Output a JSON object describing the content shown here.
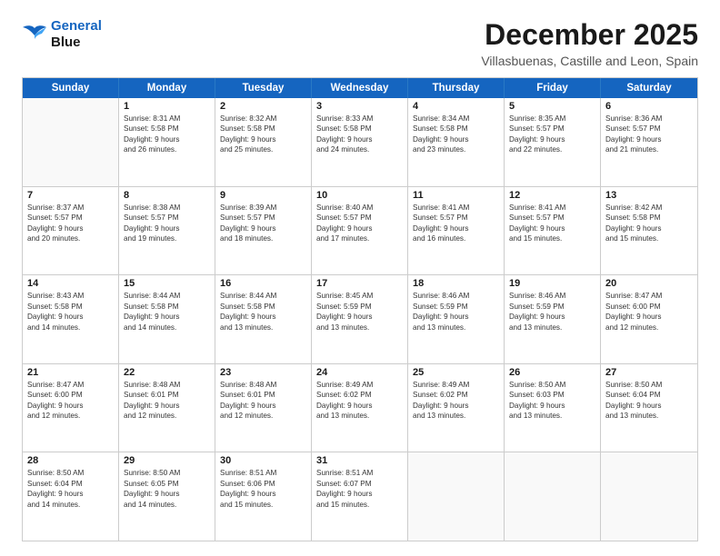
{
  "header": {
    "logo_line1": "General",
    "logo_line2": "Blue",
    "month_title": "December 2025",
    "location": "Villasbuenas, Castille and Leon, Spain"
  },
  "days_of_week": [
    "Sunday",
    "Monday",
    "Tuesday",
    "Wednesday",
    "Thursday",
    "Friday",
    "Saturday"
  ],
  "weeks": [
    [
      {
        "day": "",
        "info": ""
      },
      {
        "day": "1",
        "info": "Sunrise: 8:31 AM\nSunset: 5:58 PM\nDaylight: 9 hours\nand 26 minutes."
      },
      {
        "day": "2",
        "info": "Sunrise: 8:32 AM\nSunset: 5:58 PM\nDaylight: 9 hours\nand 25 minutes."
      },
      {
        "day": "3",
        "info": "Sunrise: 8:33 AM\nSunset: 5:58 PM\nDaylight: 9 hours\nand 24 minutes."
      },
      {
        "day": "4",
        "info": "Sunrise: 8:34 AM\nSunset: 5:58 PM\nDaylight: 9 hours\nand 23 minutes."
      },
      {
        "day": "5",
        "info": "Sunrise: 8:35 AM\nSunset: 5:57 PM\nDaylight: 9 hours\nand 22 minutes."
      },
      {
        "day": "6",
        "info": "Sunrise: 8:36 AM\nSunset: 5:57 PM\nDaylight: 9 hours\nand 21 minutes."
      }
    ],
    [
      {
        "day": "7",
        "info": "Sunrise: 8:37 AM\nSunset: 5:57 PM\nDaylight: 9 hours\nand 20 minutes."
      },
      {
        "day": "8",
        "info": "Sunrise: 8:38 AM\nSunset: 5:57 PM\nDaylight: 9 hours\nand 19 minutes."
      },
      {
        "day": "9",
        "info": "Sunrise: 8:39 AM\nSunset: 5:57 PM\nDaylight: 9 hours\nand 18 minutes."
      },
      {
        "day": "10",
        "info": "Sunrise: 8:40 AM\nSunset: 5:57 PM\nDaylight: 9 hours\nand 17 minutes."
      },
      {
        "day": "11",
        "info": "Sunrise: 8:41 AM\nSunset: 5:57 PM\nDaylight: 9 hours\nand 16 minutes."
      },
      {
        "day": "12",
        "info": "Sunrise: 8:41 AM\nSunset: 5:57 PM\nDaylight: 9 hours\nand 15 minutes."
      },
      {
        "day": "13",
        "info": "Sunrise: 8:42 AM\nSunset: 5:58 PM\nDaylight: 9 hours\nand 15 minutes."
      }
    ],
    [
      {
        "day": "14",
        "info": "Sunrise: 8:43 AM\nSunset: 5:58 PM\nDaylight: 9 hours\nand 14 minutes."
      },
      {
        "day": "15",
        "info": "Sunrise: 8:44 AM\nSunset: 5:58 PM\nDaylight: 9 hours\nand 14 minutes."
      },
      {
        "day": "16",
        "info": "Sunrise: 8:44 AM\nSunset: 5:58 PM\nDaylight: 9 hours\nand 13 minutes."
      },
      {
        "day": "17",
        "info": "Sunrise: 8:45 AM\nSunset: 5:59 PM\nDaylight: 9 hours\nand 13 minutes."
      },
      {
        "day": "18",
        "info": "Sunrise: 8:46 AM\nSunset: 5:59 PM\nDaylight: 9 hours\nand 13 minutes."
      },
      {
        "day": "19",
        "info": "Sunrise: 8:46 AM\nSunset: 5:59 PM\nDaylight: 9 hours\nand 13 minutes."
      },
      {
        "day": "20",
        "info": "Sunrise: 8:47 AM\nSunset: 6:00 PM\nDaylight: 9 hours\nand 12 minutes."
      }
    ],
    [
      {
        "day": "21",
        "info": "Sunrise: 8:47 AM\nSunset: 6:00 PM\nDaylight: 9 hours\nand 12 minutes."
      },
      {
        "day": "22",
        "info": "Sunrise: 8:48 AM\nSunset: 6:01 PM\nDaylight: 9 hours\nand 12 minutes."
      },
      {
        "day": "23",
        "info": "Sunrise: 8:48 AM\nSunset: 6:01 PM\nDaylight: 9 hours\nand 12 minutes."
      },
      {
        "day": "24",
        "info": "Sunrise: 8:49 AM\nSunset: 6:02 PM\nDaylight: 9 hours\nand 13 minutes."
      },
      {
        "day": "25",
        "info": "Sunrise: 8:49 AM\nSunset: 6:02 PM\nDaylight: 9 hours\nand 13 minutes."
      },
      {
        "day": "26",
        "info": "Sunrise: 8:50 AM\nSunset: 6:03 PM\nDaylight: 9 hours\nand 13 minutes."
      },
      {
        "day": "27",
        "info": "Sunrise: 8:50 AM\nSunset: 6:04 PM\nDaylight: 9 hours\nand 13 minutes."
      }
    ],
    [
      {
        "day": "28",
        "info": "Sunrise: 8:50 AM\nSunset: 6:04 PM\nDaylight: 9 hours\nand 14 minutes."
      },
      {
        "day": "29",
        "info": "Sunrise: 8:50 AM\nSunset: 6:05 PM\nDaylight: 9 hours\nand 14 minutes."
      },
      {
        "day": "30",
        "info": "Sunrise: 8:51 AM\nSunset: 6:06 PM\nDaylight: 9 hours\nand 15 minutes."
      },
      {
        "day": "31",
        "info": "Sunrise: 8:51 AM\nSunset: 6:07 PM\nDaylight: 9 hours\nand 15 minutes."
      },
      {
        "day": "",
        "info": ""
      },
      {
        "day": "",
        "info": ""
      },
      {
        "day": "",
        "info": ""
      }
    ]
  ]
}
